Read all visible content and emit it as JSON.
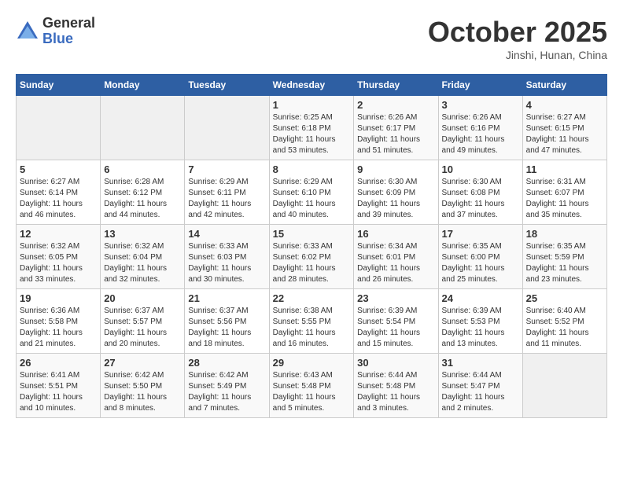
{
  "header": {
    "logo_general": "General",
    "logo_blue": "Blue",
    "month": "October 2025",
    "location": "Jinshi, Hunan, China"
  },
  "days_of_week": [
    "Sunday",
    "Monday",
    "Tuesday",
    "Wednesday",
    "Thursday",
    "Friday",
    "Saturday"
  ],
  "weeks": [
    [
      {
        "day": "",
        "info": ""
      },
      {
        "day": "",
        "info": ""
      },
      {
        "day": "",
        "info": ""
      },
      {
        "day": "1",
        "info": "Sunrise: 6:25 AM\nSunset: 6:18 PM\nDaylight: 11 hours and 53 minutes."
      },
      {
        "day": "2",
        "info": "Sunrise: 6:26 AM\nSunset: 6:17 PM\nDaylight: 11 hours and 51 minutes."
      },
      {
        "day": "3",
        "info": "Sunrise: 6:26 AM\nSunset: 6:16 PM\nDaylight: 11 hours and 49 minutes."
      },
      {
        "day": "4",
        "info": "Sunrise: 6:27 AM\nSunset: 6:15 PM\nDaylight: 11 hours and 47 minutes."
      }
    ],
    [
      {
        "day": "5",
        "info": "Sunrise: 6:27 AM\nSunset: 6:14 PM\nDaylight: 11 hours and 46 minutes."
      },
      {
        "day": "6",
        "info": "Sunrise: 6:28 AM\nSunset: 6:12 PM\nDaylight: 11 hours and 44 minutes."
      },
      {
        "day": "7",
        "info": "Sunrise: 6:29 AM\nSunset: 6:11 PM\nDaylight: 11 hours and 42 minutes."
      },
      {
        "day": "8",
        "info": "Sunrise: 6:29 AM\nSunset: 6:10 PM\nDaylight: 11 hours and 40 minutes."
      },
      {
        "day": "9",
        "info": "Sunrise: 6:30 AM\nSunset: 6:09 PM\nDaylight: 11 hours and 39 minutes."
      },
      {
        "day": "10",
        "info": "Sunrise: 6:30 AM\nSunset: 6:08 PM\nDaylight: 11 hours and 37 minutes."
      },
      {
        "day": "11",
        "info": "Sunrise: 6:31 AM\nSunset: 6:07 PM\nDaylight: 11 hours and 35 minutes."
      }
    ],
    [
      {
        "day": "12",
        "info": "Sunrise: 6:32 AM\nSunset: 6:05 PM\nDaylight: 11 hours and 33 minutes."
      },
      {
        "day": "13",
        "info": "Sunrise: 6:32 AM\nSunset: 6:04 PM\nDaylight: 11 hours and 32 minutes."
      },
      {
        "day": "14",
        "info": "Sunrise: 6:33 AM\nSunset: 6:03 PM\nDaylight: 11 hours and 30 minutes."
      },
      {
        "day": "15",
        "info": "Sunrise: 6:33 AM\nSunset: 6:02 PM\nDaylight: 11 hours and 28 minutes."
      },
      {
        "day": "16",
        "info": "Sunrise: 6:34 AM\nSunset: 6:01 PM\nDaylight: 11 hours and 26 minutes."
      },
      {
        "day": "17",
        "info": "Sunrise: 6:35 AM\nSunset: 6:00 PM\nDaylight: 11 hours and 25 minutes."
      },
      {
        "day": "18",
        "info": "Sunrise: 6:35 AM\nSunset: 5:59 PM\nDaylight: 11 hours and 23 minutes."
      }
    ],
    [
      {
        "day": "19",
        "info": "Sunrise: 6:36 AM\nSunset: 5:58 PM\nDaylight: 11 hours and 21 minutes."
      },
      {
        "day": "20",
        "info": "Sunrise: 6:37 AM\nSunset: 5:57 PM\nDaylight: 11 hours and 20 minutes."
      },
      {
        "day": "21",
        "info": "Sunrise: 6:37 AM\nSunset: 5:56 PM\nDaylight: 11 hours and 18 minutes."
      },
      {
        "day": "22",
        "info": "Sunrise: 6:38 AM\nSunset: 5:55 PM\nDaylight: 11 hours and 16 minutes."
      },
      {
        "day": "23",
        "info": "Sunrise: 6:39 AM\nSunset: 5:54 PM\nDaylight: 11 hours and 15 minutes."
      },
      {
        "day": "24",
        "info": "Sunrise: 6:39 AM\nSunset: 5:53 PM\nDaylight: 11 hours and 13 minutes."
      },
      {
        "day": "25",
        "info": "Sunrise: 6:40 AM\nSunset: 5:52 PM\nDaylight: 11 hours and 11 minutes."
      }
    ],
    [
      {
        "day": "26",
        "info": "Sunrise: 6:41 AM\nSunset: 5:51 PM\nDaylight: 11 hours and 10 minutes."
      },
      {
        "day": "27",
        "info": "Sunrise: 6:42 AM\nSunset: 5:50 PM\nDaylight: 11 hours and 8 minutes."
      },
      {
        "day": "28",
        "info": "Sunrise: 6:42 AM\nSunset: 5:49 PM\nDaylight: 11 hours and 7 minutes."
      },
      {
        "day": "29",
        "info": "Sunrise: 6:43 AM\nSunset: 5:48 PM\nDaylight: 11 hours and 5 minutes."
      },
      {
        "day": "30",
        "info": "Sunrise: 6:44 AM\nSunset: 5:48 PM\nDaylight: 11 hours and 3 minutes."
      },
      {
        "day": "31",
        "info": "Sunrise: 6:44 AM\nSunset: 5:47 PM\nDaylight: 11 hours and 2 minutes."
      },
      {
        "day": "",
        "info": ""
      }
    ]
  ]
}
